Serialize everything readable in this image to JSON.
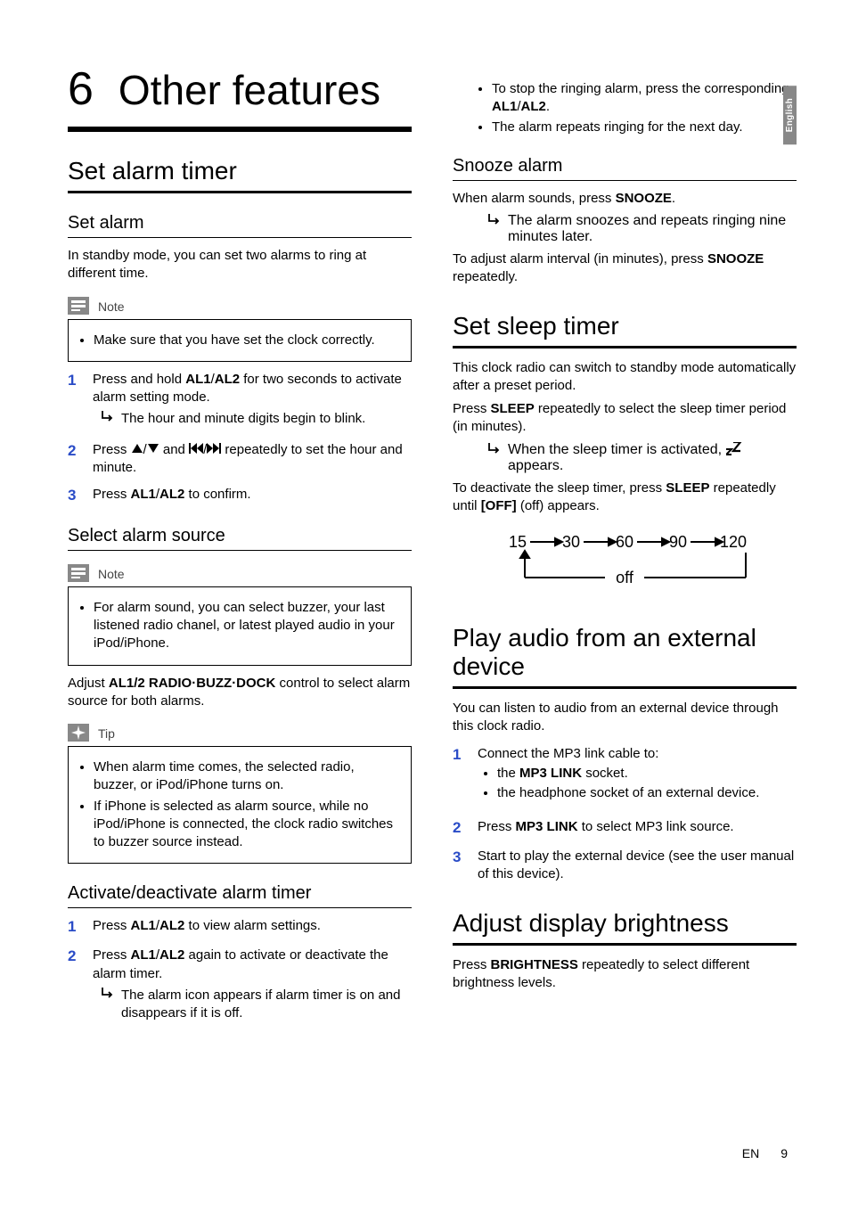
{
  "language_tab": "English",
  "chapter": {
    "number": "6",
    "title": "Other features"
  },
  "left": {
    "h2_set_alarm_timer": "Set alarm timer",
    "h3_set_alarm": "Set alarm",
    "p_intro": "In standby mode, you can set two alarms to ring at different time.",
    "note1": {
      "label": "Note",
      "items": [
        "Make sure that you have set the clock correctly."
      ]
    },
    "steps1": {
      "s1a": "Press and hold ",
      "s1b": "AL1",
      "s1c": "/",
      "s1d": "AL2",
      "s1e": " for two seconds to activate alarm setting mode.",
      "s1r": "The hour and minute digits begin to blink.",
      "s2a": "Press ",
      "s2b": " and ",
      "s2c": " repeatedly to set the hour and minute.",
      "s3a": "Press ",
      "s3b": "AL1",
      "s3c": "/",
      "s3d": "AL2",
      "s3e": " to confirm."
    },
    "h3_select_source": "Select alarm source",
    "note2": {
      "label": "Note",
      "items": [
        "For alarm sound, you can select buzzer, your last listened radio chanel, or latest played audio in your iPod/iPhone."
      ]
    },
    "p_adjust_a": "Adjust ",
    "p_adjust_b": "AL1/2 RADIO·BUZZ·DOCK",
    "p_adjust_c": " control to select alarm source for both alarms.",
    "tip": {
      "label": "Tip",
      "items": [
        "When alarm time comes, the selected radio, buzzer, or iPod/iPhone turns on.",
        "If iPhone is selected as alarm source, while no iPod/iPhone is connected, the clock radio switches to buzzer source instead."
      ]
    },
    "h3_activate": "Activate/deactivate alarm timer",
    "steps2": {
      "s1a": "Press ",
      "s1b": "AL1",
      "s1c": "/",
      "s1d": "AL2",
      "s1e": " to view alarm settings.",
      "s2a": "Press ",
      "s2b": "AL1",
      "s2c": "/",
      "s2d": "AL2",
      "s2e": " again to activate or deactivate the alarm timer.",
      "s2r": "The alarm icon appears if alarm timer is on and disappears if it is off."
    }
  },
  "right": {
    "top_bullets": {
      "b1a": "To stop the ringing alarm, press the corresponding ",
      "b1b": "AL1",
      "b1c": "/",
      "b1d": "AL2",
      "b1e": ".",
      "b2": "The alarm repeats ringing for the next day."
    },
    "h3_snooze": "Snooze alarm",
    "p_snooze_a": "When alarm sounds, press ",
    "p_snooze_b": "SNOOZE",
    "p_snooze_c": ".",
    "r_snooze": "The alarm snoozes and repeats ringing nine minutes later.",
    "p_snooze2a": "To adjust alarm interval (in minutes), press ",
    "p_snooze2b": "SNOOZE",
    "p_snooze2c": " repeatedly.",
    "h2_sleep": "Set sleep timer",
    "p_sleep1": "This clock radio can switch to standby mode automatically after a preset period.",
    "p_sleep2a": "Press ",
    "p_sleep2b": "SLEEP",
    "p_sleep2c": " repeatedly to select the sleep timer period (in minutes).",
    "r_sleep_a": "When the sleep timer is activated, ",
    "r_sleep_b": " appears.",
    "p_sleep3a": "To deactivate the sleep timer, press ",
    "p_sleep3b": "SLEEP",
    "p_sleep3c": " repeatedly until ",
    "p_sleep3d": "[OFF]",
    "p_sleep3e": " (off) appears.",
    "sleep_values": {
      "v1": "15",
      "v2": "30",
      "v3": "60",
      "v4": "90",
      "v5": "120",
      "off": "off"
    },
    "h2_ext": "Play audio from an external device",
    "p_ext": "You can listen to audio from an external device through this clock radio.",
    "steps_ext": {
      "s1": "Connect the MP3 link cable to:",
      "s1b1a": "the ",
      "s1b1b": "MP3 LINK",
      "s1b1c": " socket.",
      "s1b2": "the headphone socket of an external device.",
      "s2a": "Press ",
      "s2b": "MP3 LINK",
      "s2c": " to select MP3 link source.",
      "s3": "Start to play the external device (see the user manual of this device)."
    },
    "h2_bright": "Adjust display brightness",
    "p_bright_a": "Press ",
    "p_bright_b": "BRIGHTNESS",
    "p_bright_c": " repeatedly to select different brightness levels."
  },
  "footer": {
    "lang": "EN",
    "page": "9"
  }
}
